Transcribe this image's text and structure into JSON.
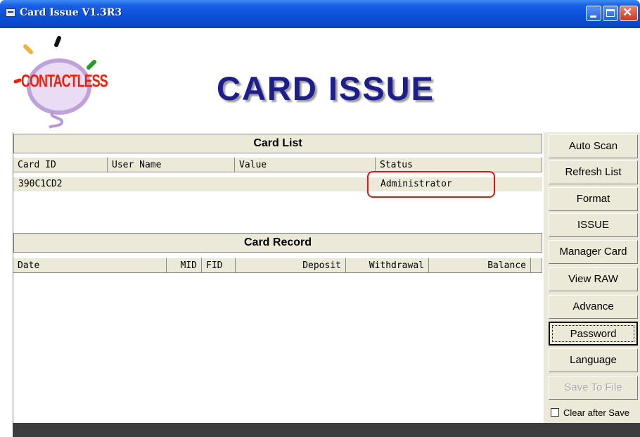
{
  "window": {
    "title": "Card Issue V1.3R3"
  },
  "header": {
    "logo_text": "CONTACTLESS",
    "title": "CARD ISSUE"
  },
  "card_list": {
    "title": "Card List",
    "columns": [
      "Card ID",
      "User Name",
      "Value",
      "Status"
    ],
    "rows": [
      {
        "card_id": "390C1CD2",
        "user_name": "",
        "value": "",
        "status": "Administrator"
      }
    ]
  },
  "card_record": {
    "title": "Card Record",
    "columns": [
      "Date",
      "MID",
      "FID",
      "Deposit",
      "Withdrawal",
      "Balance"
    ],
    "rows": []
  },
  "sidebar": {
    "buttons": [
      {
        "label": "Auto Scan",
        "enabled": true
      },
      {
        "label": "Refresh List",
        "enabled": true
      },
      {
        "label": "Format",
        "enabled": true
      },
      {
        "label": "ISSUE",
        "enabled": true
      },
      {
        "label": "Manager Card",
        "enabled": true
      },
      {
        "label": "View RAW",
        "enabled": true
      },
      {
        "label": "Advance",
        "enabled": true
      },
      {
        "label": "Password",
        "enabled": true,
        "focused": true
      },
      {
        "label": "Language",
        "enabled": true
      },
      {
        "label": "Save To File",
        "enabled": false
      }
    ],
    "clear_after_save": {
      "label": "Clear after Save",
      "checked": false
    }
  },
  "colors": {
    "title_bar": "#0a4fd8",
    "panel": "#ece9d8",
    "title_text": "#1d1d8c",
    "highlight_box": "#e11111"
  }
}
